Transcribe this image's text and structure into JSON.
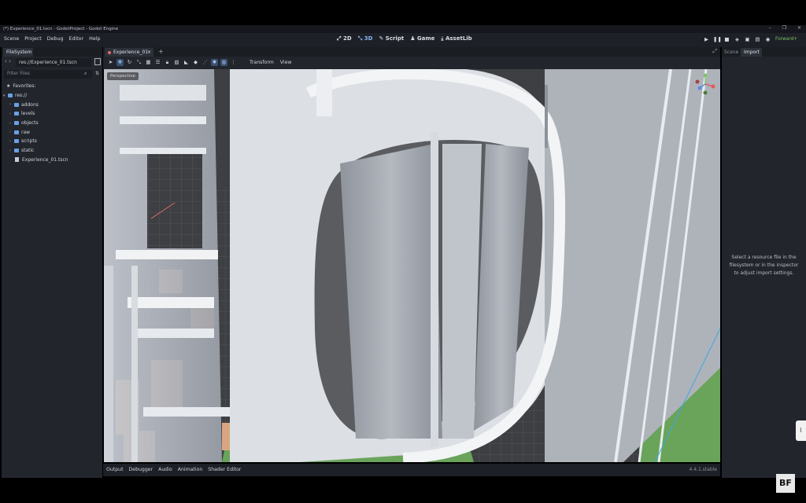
{
  "window": {
    "title": "(*) Experience_01.tscn - GodotProject - Godot Engine",
    "controls": [
      "–",
      "❐",
      "×"
    ]
  },
  "menu": {
    "items": [
      "Scene",
      "Project",
      "Debug",
      "Editor",
      "Help"
    ],
    "modes": [
      {
        "icon": "2d-icon",
        "label": "2D"
      },
      {
        "icon": "3d-icon",
        "label": "3D",
        "active": true
      },
      {
        "icon": "script-icon",
        "label": "Script"
      },
      {
        "icon": "game-icon",
        "label": "Game"
      },
      {
        "icon": "assetlib-icon",
        "label": "AssetLib"
      }
    ],
    "renderer": "Forward+"
  },
  "filesystem": {
    "tab": "FileSystem",
    "path": "res://Experience_01.tscn",
    "filter_placeholder": "Filter Files",
    "favorites_label": "Favorites:",
    "root": "res://",
    "folders": [
      "addons",
      "levels",
      "objects",
      "raw",
      "scripts",
      "static"
    ],
    "file": "Experience_01.tscn"
  },
  "editor": {
    "scene_tab": "Experience_01",
    "toolbar_menus": [
      "Transform",
      "View"
    ],
    "viewport_label": "Perspective"
  },
  "bottom_panel": {
    "tabs": [
      "Output",
      "Debugger",
      "Audio",
      "Animation",
      "Shader Editor"
    ],
    "version": "4.4.1.stable"
  },
  "right_dock": {
    "tabs": [
      "Scene",
      "Import"
    ],
    "message": "Select a resource file in the filesystem or in the inspector to adjust import settings."
  },
  "overlay": {
    "logo": "BF"
  },
  "colors": {
    "accent": "#8cb4f5",
    "renderer": "#7ec36a",
    "panel": "#22252c",
    "folder": "#6aa0e6"
  }
}
